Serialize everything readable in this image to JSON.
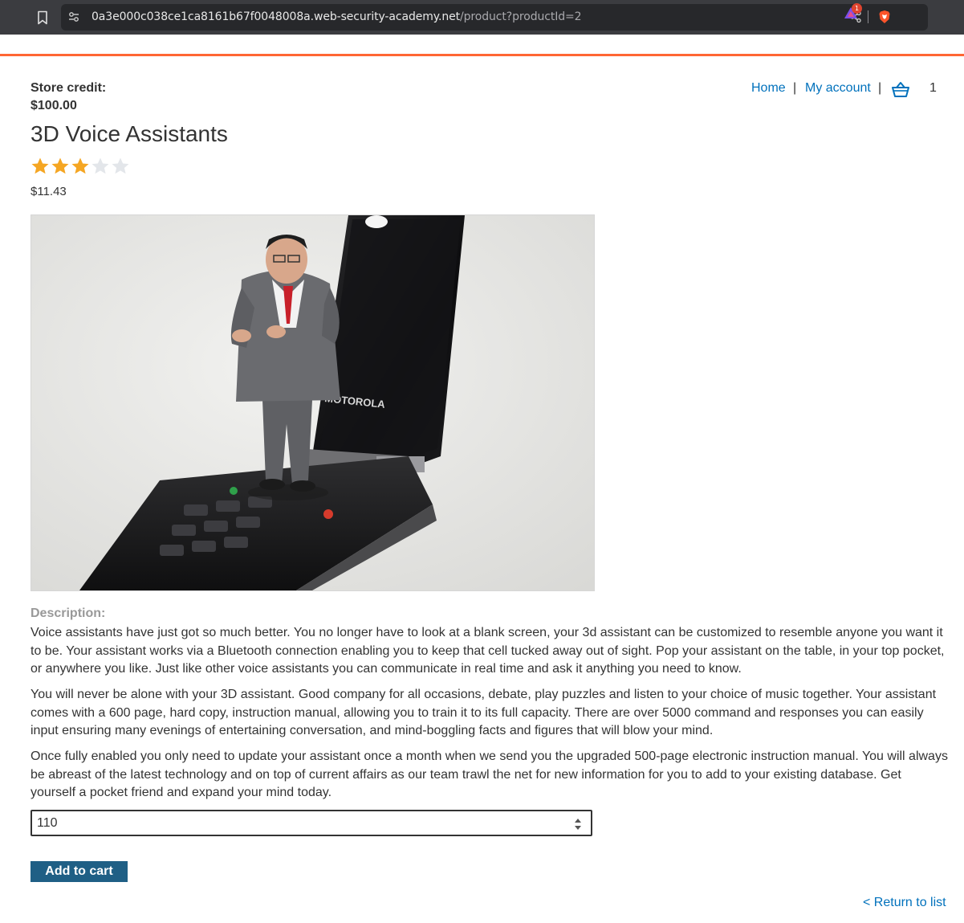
{
  "browser": {
    "url_domain": "0a3e000c038ce1ca8161b67f0048008a.web-security-academy.net",
    "url_path": "/product?productId=2",
    "rewards_badge": "1"
  },
  "header": {
    "store_credit_label": "Store credit:",
    "store_credit_value": "$100.00",
    "nav": {
      "home": "Home",
      "separator": "|",
      "my_account": "My account",
      "cart_count": "1"
    }
  },
  "product": {
    "title": "3D Voice Assistants",
    "rating": 3,
    "rating_max": 5,
    "price": "$11.43",
    "image_alt": "3D Voice Assistants",
    "description_label": "Description:",
    "description": [
      "Voice assistants have just got so much better. You no longer have to look at a blank screen, your 3d assistant can be customized to resemble anyone you want it to be. Your assistant works via a Bluetooth connection enabling you to keep that cell tucked away out of sight. Pop your assistant on the table, in your top pocket, or anywhere you like. Just like other voice assistants you can communicate in real time and ask it anything you need to know.",
      "You will never be alone with your 3D assistant. Good company for all occasions, debate, play puzzles and listen to your choice of music together. Your assistant comes with a 600 page, hard copy, instruction manual, allowing you to train it to its full capacity. There are over 5000 command and responses you can easily input ensuring many evenings of entertaining conversation, and mind-boggling facts and figures that will blow your mind.",
      "Once fully enabled you only need to update your assistant once a month when we send you the upgraded 500-page electronic instruction manual. You will always be abreast of the latest technology and on top of current affairs as our team trawl the net for new information for you to add to your existing database. Get yourself a pocket friend and expand your mind today."
    ],
    "quantity": "110",
    "add_to_cart_label": "Add to cart",
    "return_link": "< Return to list"
  },
  "colors": {
    "accent_line": "#ff6633",
    "link": "#0071bc",
    "button": "#1f5f85",
    "star_filled": "#f5a623",
    "star_empty": "#e3e6ea"
  }
}
